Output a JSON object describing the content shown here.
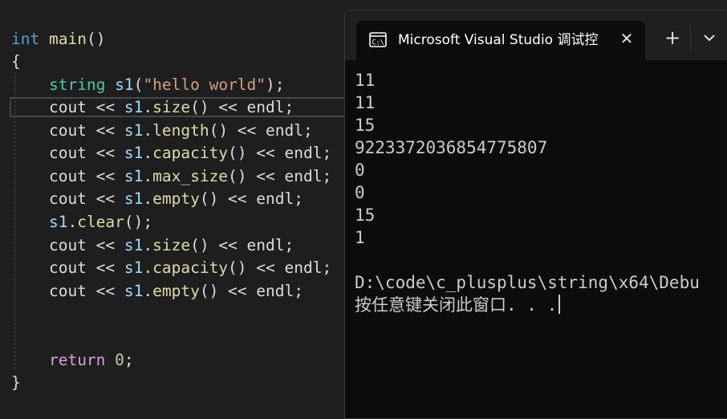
{
  "editor": {
    "lines": [
      [
        {
          "t": "int",
          "c": "#569cd6"
        },
        {
          "t": " ",
          "c": "#dcdcdc"
        },
        {
          "t": "main",
          "c": "#dcdcaa"
        },
        {
          "t": "()",
          "c": "#dcdcdc"
        }
      ],
      [
        {
          "t": "{",
          "c": "#dcdcdc"
        }
      ],
      [
        {
          "t": "    ",
          "c": "#dcdcdc"
        },
        {
          "t": "string",
          "c": "#4ec9b0"
        },
        {
          "t": " ",
          "c": "#dcdcdc"
        },
        {
          "t": "s1",
          "c": "#9cdcfe"
        },
        {
          "t": "(",
          "c": "#dcdcdc"
        },
        {
          "t": "\"hello world\"",
          "c": "#d69d85"
        },
        {
          "t": ");",
          "c": "#dcdcdc"
        }
      ],
      [
        {
          "t": "    cout << ",
          "c": "#dcdcdc"
        },
        {
          "t": "s1",
          "c": "#9cdcfe"
        },
        {
          "t": ".",
          "c": "#dcdcdc"
        },
        {
          "t": "size",
          "c": "#dcdcaa"
        },
        {
          "t": "() << endl;",
          "c": "#dcdcdc"
        }
      ],
      [
        {
          "t": "    cout << ",
          "c": "#dcdcdc"
        },
        {
          "t": "s1",
          "c": "#9cdcfe"
        },
        {
          "t": ".",
          "c": "#dcdcdc"
        },
        {
          "t": "length",
          "c": "#dcdcaa"
        },
        {
          "t": "() << endl;",
          "c": "#dcdcdc"
        }
      ],
      [
        {
          "t": "    cout << ",
          "c": "#dcdcdc"
        },
        {
          "t": "s1",
          "c": "#9cdcfe"
        },
        {
          "t": ".",
          "c": "#dcdcdc"
        },
        {
          "t": "capacity",
          "c": "#dcdcaa"
        },
        {
          "t": "() << endl;",
          "c": "#dcdcdc"
        }
      ],
      [
        {
          "t": "    cout << ",
          "c": "#dcdcdc"
        },
        {
          "t": "s1",
          "c": "#9cdcfe"
        },
        {
          "t": ".",
          "c": "#dcdcdc"
        },
        {
          "t": "max_size",
          "c": "#dcdcaa"
        },
        {
          "t": "() << endl;",
          "c": "#dcdcdc"
        }
      ],
      [
        {
          "t": "    cout << ",
          "c": "#dcdcdc"
        },
        {
          "t": "s1",
          "c": "#9cdcfe"
        },
        {
          "t": ".",
          "c": "#dcdcdc"
        },
        {
          "t": "empty",
          "c": "#dcdcaa"
        },
        {
          "t": "() << endl;",
          "c": "#dcdcdc"
        }
      ],
      [
        {
          "t": "    ",
          "c": "#dcdcdc"
        },
        {
          "t": "s1",
          "c": "#9cdcfe"
        },
        {
          "t": ".",
          "c": "#dcdcdc"
        },
        {
          "t": "clear",
          "c": "#dcdcaa"
        },
        {
          "t": "();",
          "c": "#dcdcdc"
        }
      ],
      [
        {
          "t": "    cout << ",
          "c": "#dcdcdc"
        },
        {
          "t": "s1",
          "c": "#9cdcfe"
        },
        {
          "t": ".",
          "c": "#dcdcdc"
        },
        {
          "t": "size",
          "c": "#dcdcaa"
        },
        {
          "t": "() << endl;",
          "c": "#dcdcdc"
        }
      ],
      [
        {
          "t": "    cout << ",
          "c": "#dcdcdc"
        },
        {
          "t": "s1",
          "c": "#9cdcfe"
        },
        {
          "t": ".",
          "c": "#dcdcdc"
        },
        {
          "t": "capacity",
          "c": "#dcdcaa"
        },
        {
          "t": "() << endl;",
          "c": "#dcdcdc"
        }
      ],
      [
        {
          "t": "    cout << ",
          "c": "#dcdcdc"
        },
        {
          "t": "s1",
          "c": "#9cdcfe"
        },
        {
          "t": ".",
          "c": "#dcdcdc"
        },
        {
          "t": "empty",
          "c": "#dcdcaa"
        },
        {
          "t": "() << endl;",
          "c": "#dcdcdc"
        }
      ],
      [],
      [],
      [
        {
          "t": "    ",
          "c": "#dcdcdc"
        },
        {
          "t": "return",
          "c": "#d8a0df"
        },
        {
          "t": " ",
          "c": "#dcdcdc"
        },
        {
          "t": "0",
          "c": "#b5cea8"
        },
        {
          "t": ";",
          "c": "#dcdcdc"
        }
      ],
      [
        {
          "t": "}",
          "c": "#dcdcdc"
        }
      ]
    ]
  },
  "terminal": {
    "tab_title": "Microsoft Visual Studio 调试控",
    "icon": "console-icon",
    "close_label": "✕",
    "new_tab_label": "+",
    "output_lines": [
      "11",
      "11",
      "15",
      "9223372036854775807",
      "0",
      "0",
      "15",
      "1",
      "",
      "D:\\code\\c_plusplus\\string\\x64\\Debu",
      "按任意键关闭此窗口. . ."
    ]
  }
}
